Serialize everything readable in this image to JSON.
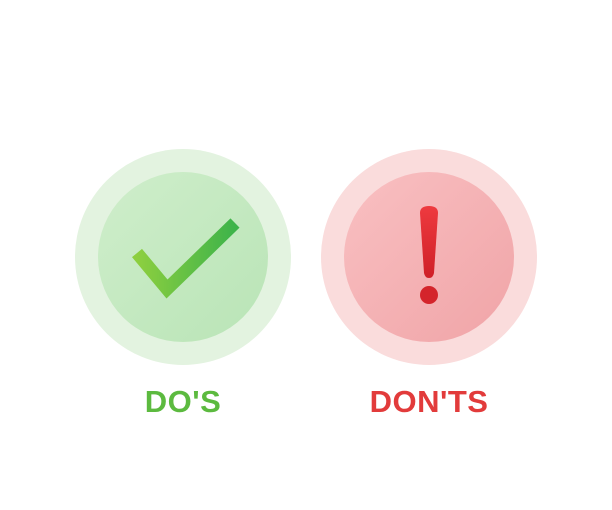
{
  "dos": {
    "label": "DO'S",
    "icon": "checkmark-icon",
    "color": "#5cba3f"
  },
  "donts": {
    "label": "DON'TS",
    "icon": "exclamation-icon",
    "color": "#e23b3b"
  }
}
